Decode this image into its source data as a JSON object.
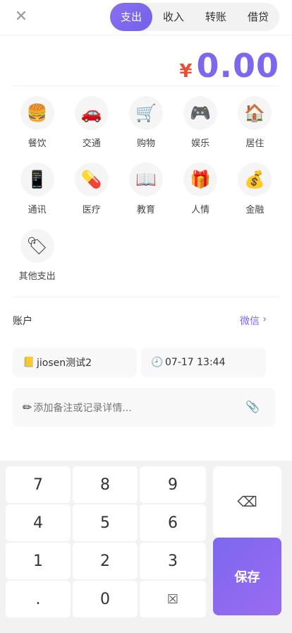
{
  "topbar": {
    "close_icon": "✕",
    "tabs": [
      {
        "label": "支出",
        "active": true
      },
      {
        "label": "收入",
        "active": false
      },
      {
        "label": "转账",
        "active": false
      },
      {
        "label": "借贷",
        "active": false
      }
    ]
  },
  "amount": {
    "currency": "¥",
    "value": "0.00",
    "value_color": "#7b68ee",
    "currency_color": "#e8503a"
  },
  "categories": [
    {
      "label": "餐饮",
      "icon": "🍔"
    },
    {
      "label": "交通",
      "icon": "🚗"
    },
    {
      "label": "购物",
      "icon": "🛒"
    },
    {
      "label": "娱乐",
      "icon": "🎮"
    },
    {
      "label": "居住",
      "icon": "🏠"
    },
    {
      "label": "通讯",
      "icon": "📱"
    },
    {
      "label": "医疗",
      "icon": "💊"
    },
    {
      "label": "教育",
      "icon": "📖"
    },
    {
      "label": "人情",
      "icon": "🎁"
    },
    {
      "label": "金融",
      "icon": "💰"
    },
    {
      "label": "其他支出",
      "icon": "🏷"
    }
  ],
  "account": {
    "label": "账户",
    "value": "微信",
    "chevron": "›"
  },
  "chips": {
    "book": {
      "icon": "📒",
      "label": "jiosen测试2"
    },
    "time": {
      "icon": "🕘",
      "label": "07-17 13:44"
    }
  },
  "note": {
    "pen_icon": "✏",
    "placeholder": "添加备注或记录详情...",
    "clip_icon": "📎"
  },
  "keypad": {
    "keys": [
      "7",
      "8",
      "9",
      "4",
      "5",
      "6",
      "1",
      "2",
      "3",
      ".",
      "0",
      "☒"
    ],
    "backspace": "⌫",
    "save": "保存"
  },
  "colors": {
    "accent": "#7b68ee"
  }
}
